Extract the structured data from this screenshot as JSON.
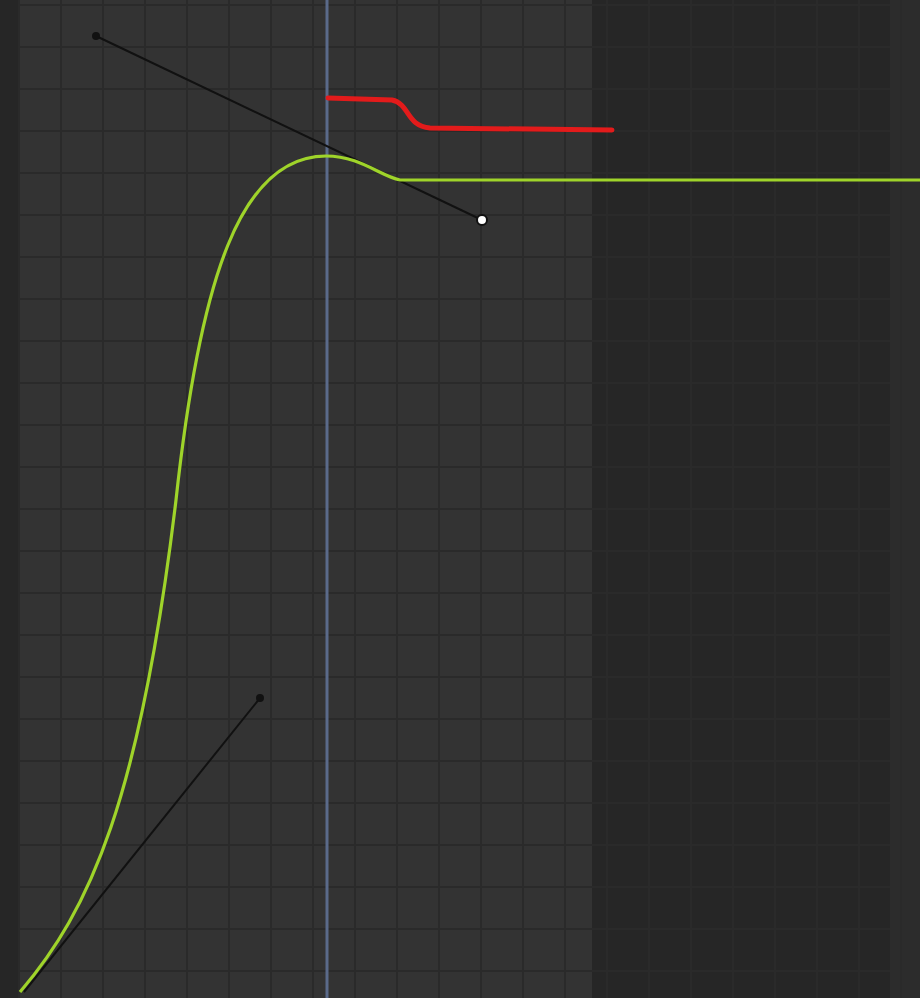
{
  "graph_editor": {
    "curves": [
      {
        "kind": "fcurve",
        "color": "#9fd42a"
      },
      {
        "kind": "annotation",
        "color": "#e31b1b"
      }
    ]
  }
}
